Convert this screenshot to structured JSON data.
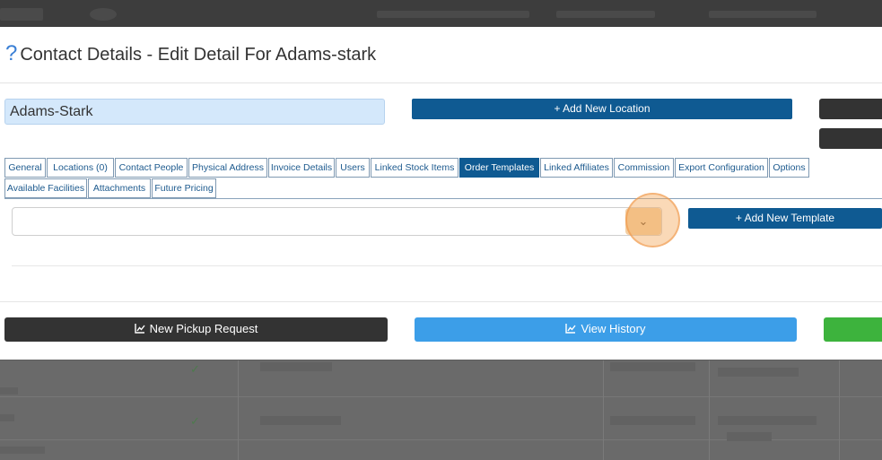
{
  "modal": {
    "title": "Contact Details - Edit Detail For Adams-stark",
    "help_icon": "question-mark-icon",
    "contact_name": "Adams-Stark",
    "add_location_label": "+ Add New Location"
  },
  "tabs": [
    {
      "label": "General",
      "active": false
    },
    {
      "label": "Locations (0)",
      "active": false
    },
    {
      "label": "Contact People",
      "active": false
    },
    {
      "label": "Physical Address",
      "active": false
    },
    {
      "label": "Invoice Details",
      "active": false
    },
    {
      "label": "Users",
      "active": false
    },
    {
      "label": "Linked Stock Items",
      "active": false
    },
    {
      "label": "Order Templates",
      "active": true
    },
    {
      "label": "Linked Affiliates",
      "active": false
    },
    {
      "label": "Commission",
      "active": false
    },
    {
      "label": "Export Configuration",
      "active": false
    },
    {
      "label": "Options",
      "active": false
    },
    {
      "label": "Available Facilities",
      "active": false
    },
    {
      "label": "Attachments",
      "active": false
    },
    {
      "label": "Future Pricing",
      "active": false
    }
  ],
  "order_templates": {
    "select_value": "",
    "add_template_label": "+ Add New Template"
  },
  "footer": {
    "pickup_label": "New Pickup Request",
    "history_label": "View History",
    "icon": "line-chart-icon"
  },
  "colors": {
    "primary": "#0f5a92",
    "history": "#3c9ee8",
    "success": "#3db33d",
    "dark": "#333333",
    "highlight": "#f4aa60"
  }
}
